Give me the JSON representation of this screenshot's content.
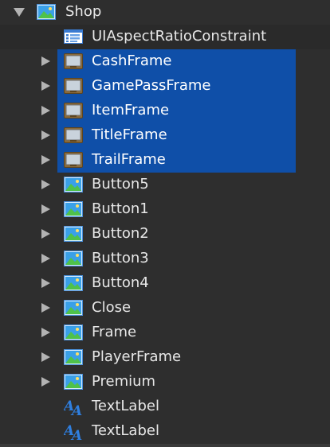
{
  "root": {
    "label": "Shop",
    "icon": "image-frame-icon",
    "expanded": true
  },
  "children": [
    {
      "label": "UIAspectRatioConstraint",
      "icon": "aspect-ratio-constraint-icon",
      "expandable": false,
      "selected": false
    },
    {
      "label": "CashFrame",
      "icon": "frame-icon",
      "expandable": true,
      "selected": true
    },
    {
      "label": "GamePassFrame",
      "icon": "frame-icon",
      "expandable": true,
      "selected": true
    },
    {
      "label": "ItemFrame",
      "icon": "frame-icon",
      "expandable": true,
      "selected": true
    },
    {
      "label": "TitleFrame",
      "icon": "frame-icon",
      "expandable": true,
      "selected": true
    },
    {
      "label": "TrailFrame",
      "icon": "frame-icon",
      "expandable": true,
      "selected": true
    },
    {
      "label": "Button5",
      "icon": "image-button-icon",
      "expandable": true,
      "selected": false
    },
    {
      "label": "Button1",
      "icon": "image-button-icon",
      "expandable": true,
      "selected": false
    },
    {
      "label": "Button2",
      "icon": "image-button-icon",
      "expandable": true,
      "selected": false
    },
    {
      "label": "Button3",
      "icon": "image-button-icon",
      "expandable": true,
      "selected": false
    },
    {
      "label": "Button4",
      "icon": "image-button-icon",
      "expandable": true,
      "selected": false
    },
    {
      "label": "Close",
      "icon": "image-button-icon",
      "expandable": true,
      "selected": false
    },
    {
      "label": "Frame",
      "icon": "image-button-icon",
      "expandable": true,
      "selected": false
    },
    {
      "label": "PlayerFrame",
      "icon": "image-button-icon",
      "expandable": true,
      "selected": false
    },
    {
      "label": "Premium",
      "icon": "image-button-icon",
      "expandable": true,
      "selected": false
    },
    {
      "label": "TextLabel",
      "icon": "text-label-icon",
      "expandable": false,
      "selected": false
    },
    {
      "label": "TextLabel",
      "icon": "text-label-icon",
      "expandable": false,
      "selected": false
    }
  ],
  "colors": {
    "background": "#2e2e2e",
    "selection": "#0f4fa8",
    "text": "#e8e8e8",
    "arrow": "#b3b3b3"
  }
}
